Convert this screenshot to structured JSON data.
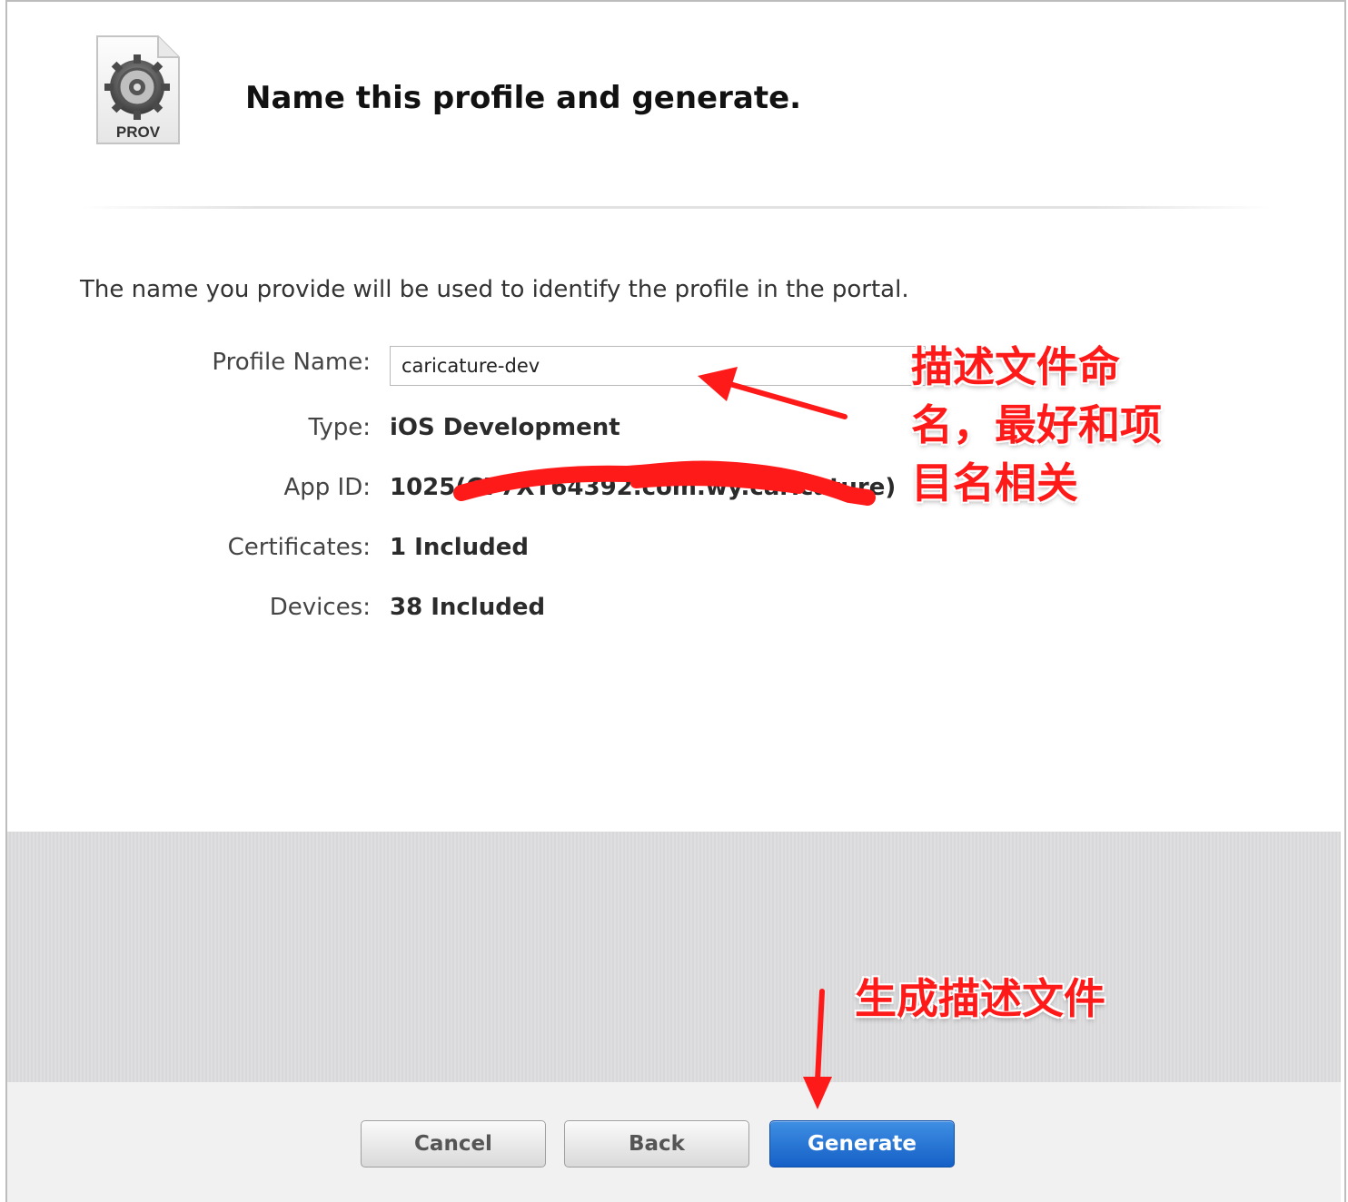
{
  "header": {
    "icon_label": "PROV",
    "title": "Name this profile and generate."
  },
  "intro_text": "The name you provide will be used to identify the profile in the portal.",
  "form": {
    "profile_name_label": "Profile Name:",
    "profile_name_value": "caricature-dev",
    "type_label": "Type:",
    "type_value": "iOS Development",
    "app_id_label": "App ID:",
    "app_id_value": "1025(C77XT64392.com.wy.caricature)",
    "certificates_label": "Certificates:",
    "certificates_value": "1 Included",
    "devices_label": "Devices:",
    "devices_value": "38 Included"
  },
  "buttons": {
    "cancel": "Cancel",
    "back": "Back",
    "generate": "Generate"
  },
  "annotations": {
    "name_note_line1": "描述文件命",
    "name_note_line2": "名，最好和项",
    "name_note_line3": "目名相关",
    "generate_note": "生成描述文件"
  },
  "colors": {
    "annotation_red": "#ff1a1a",
    "primary_button": "#1f6fd6",
    "footer_band": "#dcdcde"
  }
}
